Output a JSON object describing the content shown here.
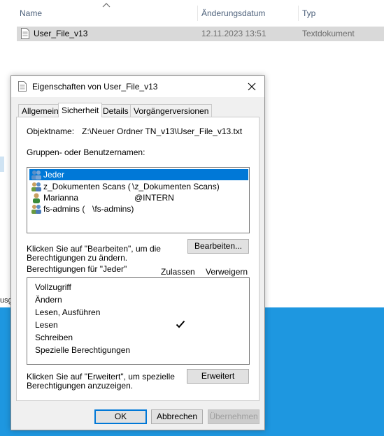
{
  "explorer": {
    "columns": {
      "name": "Name",
      "date": "Änderungsdatum",
      "type": "Typ"
    },
    "file": {
      "name": "User_File_v13",
      "date": "12.11.2023 13:51",
      "type": "Textdokument"
    },
    "side_text": "usg"
  },
  "dialog": {
    "title": "Eigenschaften von User_File_v13",
    "tabs": [
      "Allgemein",
      "Sicherheit",
      "Details",
      "Vorgängerversionen"
    ],
    "active_tab": "Sicherheit",
    "object_label": "Objektname:",
    "object_value": "Z:\\Neuer Ordner TN_v13\\User_File_v13.txt",
    "groups_label": "Gruppen- oder Benutzernamen:",
    "users": [
      {
        "name": "Jeder",
        "extra": "",
        "icon": "group-icon"
      },
      {
        "name": "z_Dokumenten Scans (",
        "extra": "\\z_Dokumenten Scans)",
        "icon": "group-icon"
      },
      {
        "name": "Marianna",
        "extra": "@INTERN",
        "icon": "user-icon"
      },
      {
        "name": "fs-admins (",
        "extra": "\\fs-admins)",
        "icon": "group-icon"
      }
    ],
    "edit_hint_line1": "Klicken Sie auf \"Bearbeiten\", um die",
    "edit_hint_line2": "Berechtigungen zu ändern.",
    "edit_button": "Bearbeiten...",
    "perm_label": "Berechtigungen für \"Jeder\"",
    "allow_header": "Zulassen",
    "deny_header": "Verweigern",
    "permissions": [
      {
        "name": "Vollzugriff",
        "allow": false
      },
      {
        "name": "Ändern",
        "allow": false
      },
      {
        "name": "Lesen, Ausführen",
        "allow": false
      },
      {
        "name": "Lesen",
        "allow": true
      },
      {
        "name": "Schreiben",
        "allow": false
      },
      {
        "name": "Spezielle Berechtigungen",
        "allow": false
      }
    ],
    "advanced_hint_line1": "Klicken Sie auf \"Erweitert\", um spezielle",
    "advanced_hint_line2": "Berechtigungen anzuzeigen.",
    "advanced_button": "Erweitert",
    "ok_button": "OK",
    "cancel_button": "Abbrechen",
    "apply_button": "Übernehmen"
  },
  "colors": {
    "selection": "#0078d7",
    "desktop": "#1e97e0",
    "file_row": "#d9d9d9",
    "header_text": "#4c607a"
  }
}
